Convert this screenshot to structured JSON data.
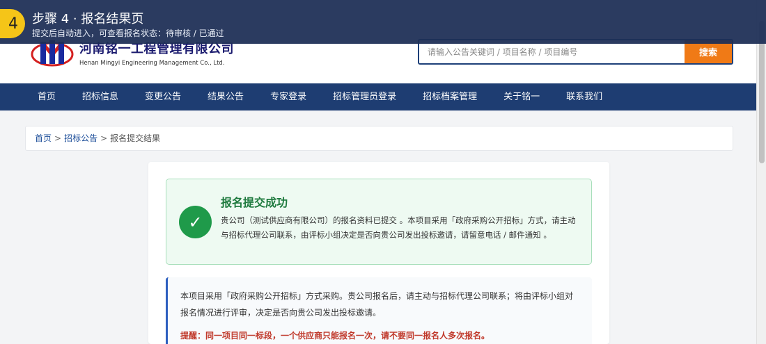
{
  "overlay": {
    "step_number": "4",
    "title": "步骤 4 · 报名结果页",
    "subtitle": "提交后自动进入，可查看报名状态：待审核 / 已通过"
  },
  "header": {
    "logo_cn": "河南铭一工程管理有限公司",
    "logo_en": "Henan Mingyi Engineering Management Co., Ltd.",
    "search_placeholder": "请输入公告关键词 / 项目名称 / 项目编号",
    "search_button": "搜索"
  },
  "nav": {
    "items": [
      "首页",
      "招标信息",
      "变更公告",
      "结果公告",
      "专家登录",
      "招标管理员登录",
      "招标档案管理",
      "关于铭一",
      "联系我们"
    ]
  },
  "breadcrumb": {
    "home": "首页",
    "section": "招标公告",
    "current": "报名提交结果",
    "sep": ">"
  },
  "success": {
    "title": "报名提交成功",
    "message": "贵公司（测试供应商有限公司）的报名资料已提交 。本项目采用「政府采购公开招标」方式，请主动与招标代理公司联系，由评标小组决定是否向贵公司发出投标邀请，请留意电话 / 邮件通知 。"
  },
  "info": {
    "text": "本项目采用「政府采购公开招标」方式采购。贵公司报名后，请主动与招标代理公司联系；将由评标小组对报名情况进行评审，决定是否向贵公司发出投标邀请。",
    "warning": "提醒：同一项目同一标段，一个供应商只能报名一次，请不要同一报名人多次报名。"
  },
  "colors": {
    "nav_bg": "#1e3d72",
    "accent_orange": "#f07a16",
    "success_green": "#1f9a4a",
    "badge_yellow": "#f5c518"
  }
}
